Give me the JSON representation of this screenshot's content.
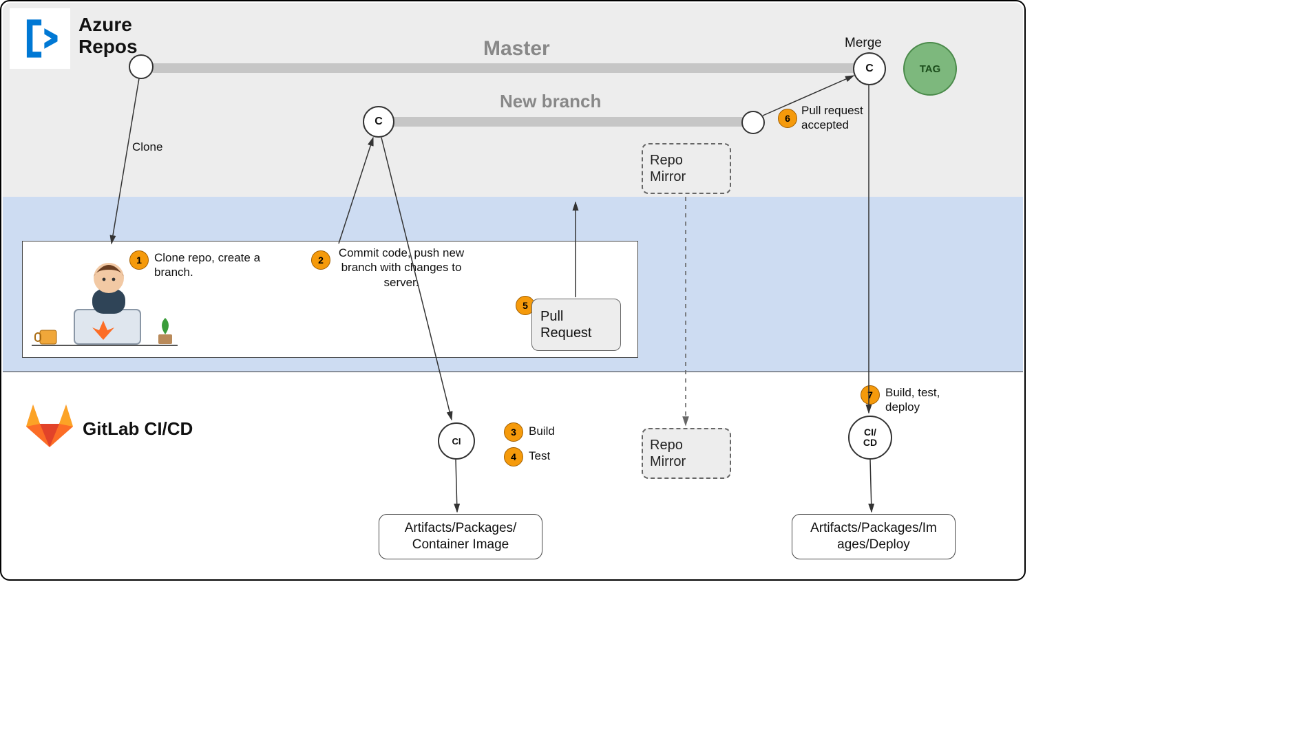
{
  "header": {
    "azure_title": "Azure\nRepos",
    "gitlab_title": "GitLab CI/CD"
  },
  "branches": {
    "master_label": "Master",
    "new_branch_label": "New branch",
    "merge_label": "Merge",
    "tag_label": "TAG"
  },
  "nodes": {
    "commit_c": "C",
    "branch_end": "",
    "merge_c": "C",
    "ci_label": "CI",
    "cicd_label": "CI/\nCD"
  },
  "labels": {
    "clone": "Clone"
  },
  "steps": {
    "s1": {
      "num": "1",
      "text": "Clone repo, create a branch."
    },
    "s2": {
      "num": "2",
      "text": "Commit code, push new branch with changes to server."
    },
    "s3": {
      "num": "3",
      "text": "Build"
    },
    "s4": {
      "num": "4",
      "text": "Test"
    },
    "s5": {
      "num": "5"
    },
    "s6": {
      "num": "6",
      "text": "Pull request accepted"
    },
    "s7": {
      "num": "7",
      "text": "Build, test, deploy"
    }
  },
  "boxes": {
    "pull_request": "Pull\nRequest",
    "repo_mirror": "Repo\nMirror",
    "artifacts_ci": "Artifacts/Packages/\nContainer Image",
    "artifacts_cd": "Artifacts/Packages/Im\nages/Deploy"
  },
  "icons": {
    "azure": "azure-repos-icon",
    "gitlab": "gitlab-icon",
    "developer": "developer-icon"
  }
}
